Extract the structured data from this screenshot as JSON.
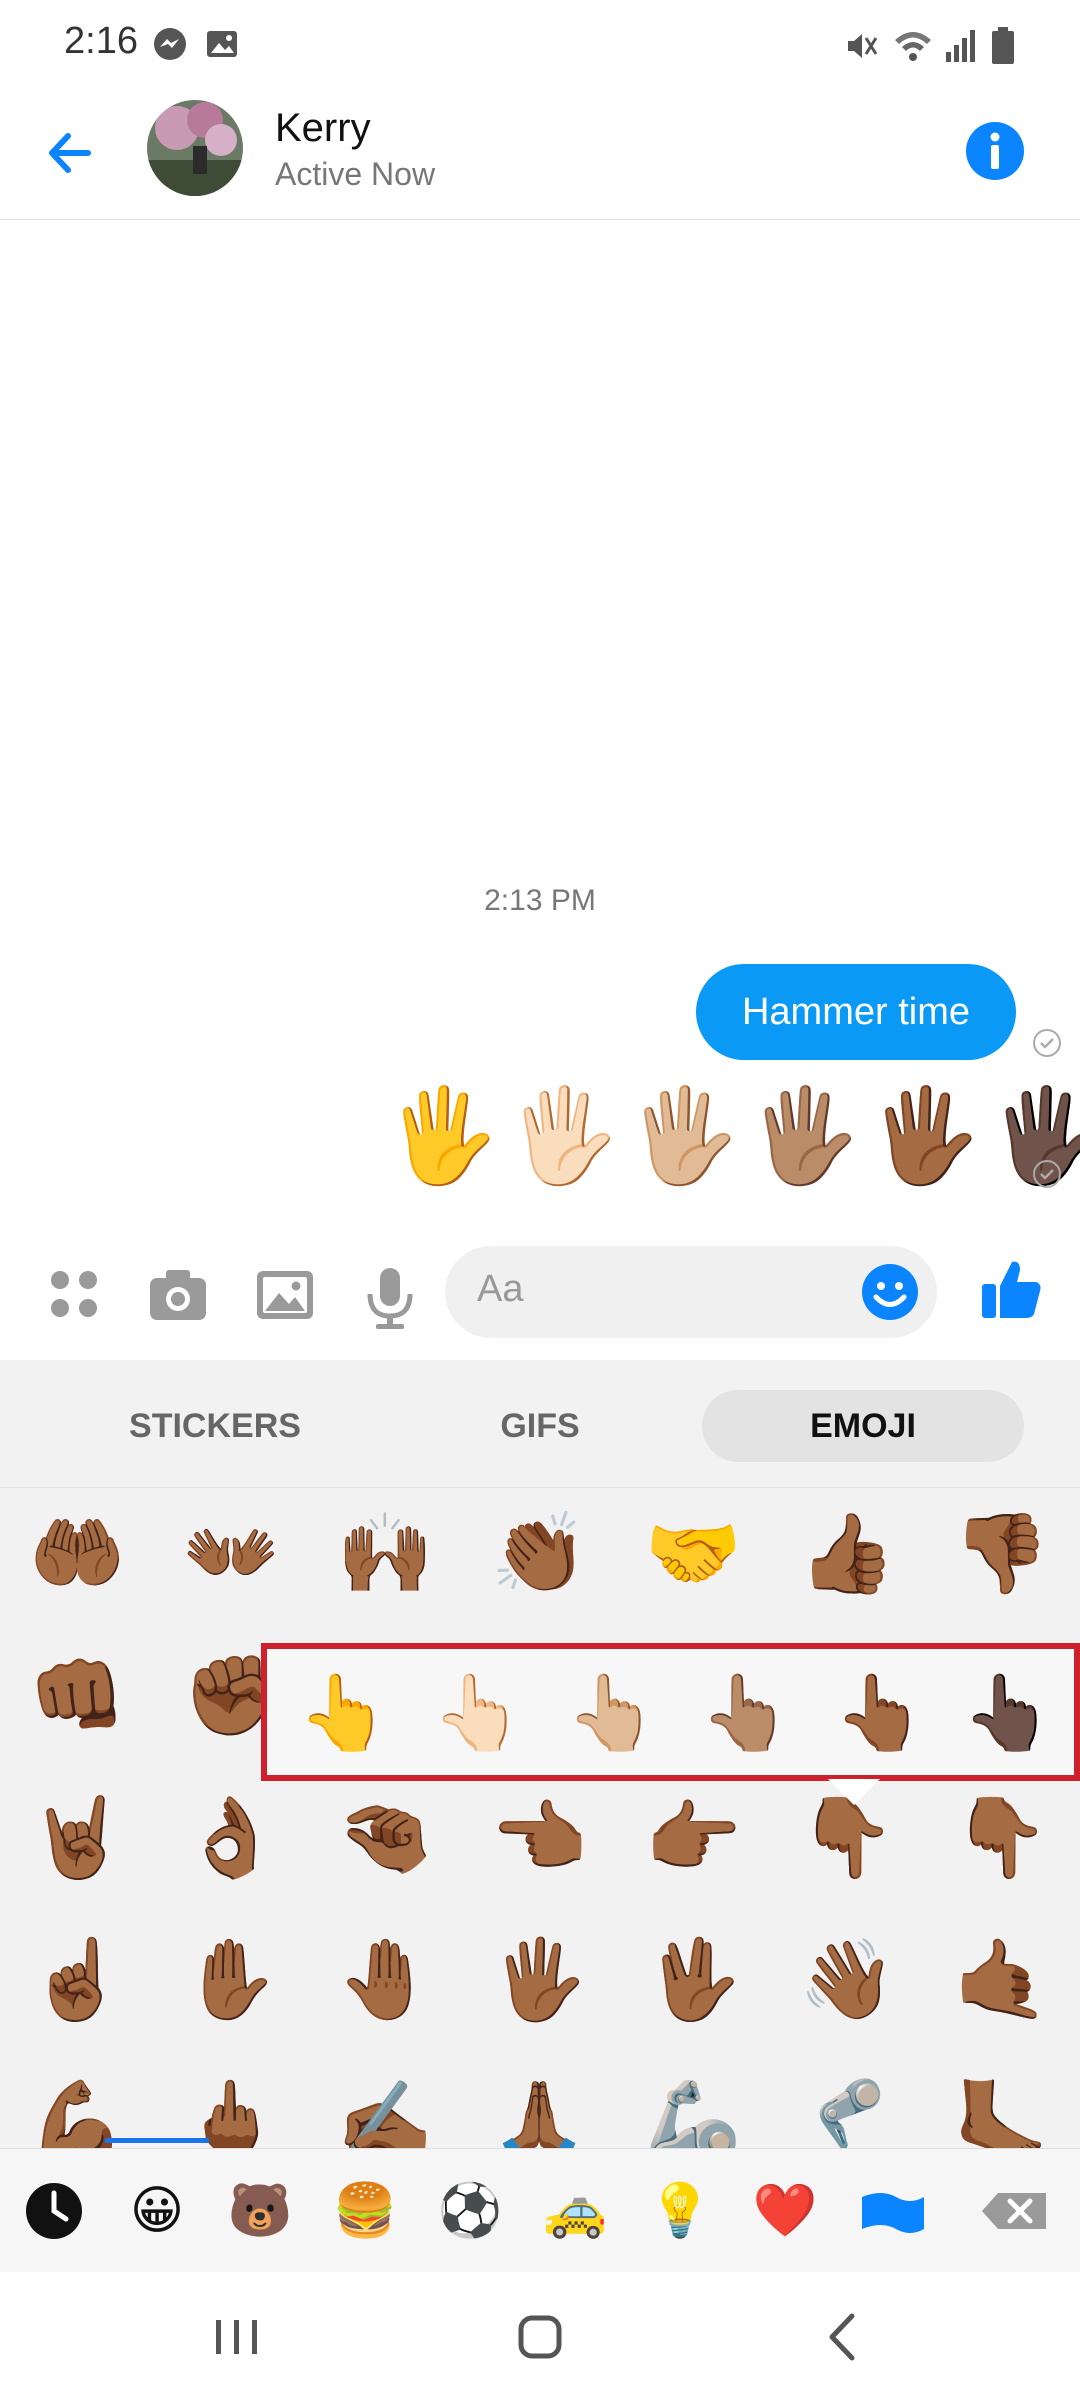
{
  "status_bar": {
    "time": "2:16"
  },
  "header": {
    "contact_name": "Kerry",
    "contact_status": "Active Now"
  },
  "conversation": {
    "timestamp": "2:13 PM",
    "sent_text": "Hammer time",
    "sent_emoji": "🖐🖐🏻🖐🏼🖐🏽🖐🏾🖐🏿"
  },
  "composer": {
    "placeholder": "Aa"
  },
  "emoji_panel": {
    "tabs": [
      "STICKERS",
      "GIFS",
      "EMOJI"
    ],
    "active_tab": "EMOJI",
    "grid_rows": [
      [
        "🤲🏾",
        "👐🏾",
        "🙌🏾",
        "👏🏾",
        "🤝",
        "👍🏾",
        "👎🏾"
      ],
      [
        "👊🏾",
        "✊🏾",
        "",
        "",
        "",
        "",
        ""
      ],
      [
        "🤘🏾",
        "👌🏾",
        "🤏🏾",
        "👈🏾",
        "👉🏾",
        "👇🏾",
        "👇🏾"
      ],
      [
        "☝🏾",
        "✋🏾",
        "🤚🏾",
        "🖐🏾",
        "🖖🏾",
        "👋🏾",
        "🤙🏾"
      ],
      [
        "💪🏾",
        "🖕🏾",
        "✍🏾",
        "🙏🏾",
        "🦾",
        "🦿",
        "🦶🏾"
      ]
    ],
    "skin_tone_options": [
      "👆",
      "👆🏻",
      "👆🏼",
      "👆🏽",
      "👆🏾",
      "👆🏿"
    ],
    "categories": [
      "recent",
      "😀",
      "🐻",
      "🍔",
      "⚽",
      "🚕",
      "💡",
      "❤️",
      "flag",
      "backspace"
    ]
  }
}
